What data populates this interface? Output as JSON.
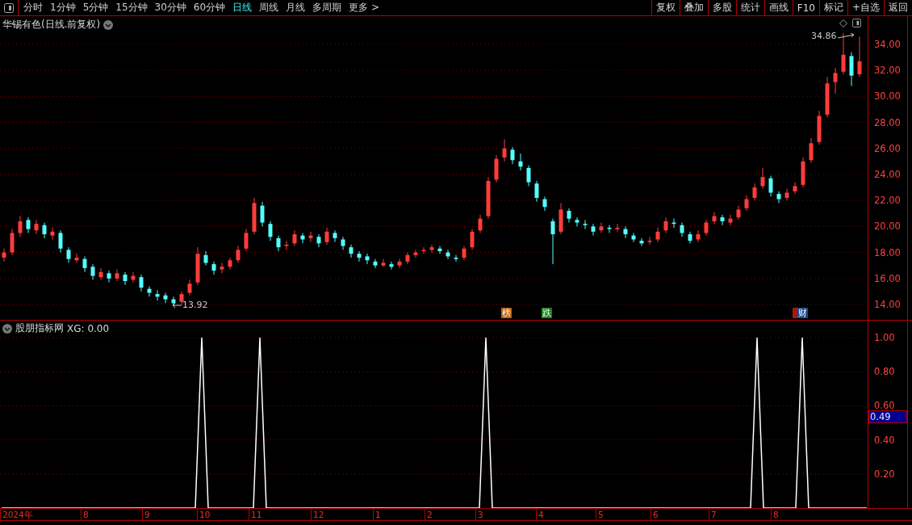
{
  "toolbar": {
    "periods": [
      {
        "label": "分时",
        "selected": false
      },
      {
        "label": "1分钟",
        "selected": false
      },
      {
        "label": "5分钟",
        "selected": false
      },
      {
        "label": "15分钟",
        "selected": false
      },
      {
        "label": "30分钟",
        "selected": false
      },
      {
        "label": "60分钟",
        "selected": false
      },
      {
        "label": "日线",
        "selected": true
      },
      {
        "label": "周线",
        "selected": false
      },
      {
        "label": "月线",
        "selected": false
      },
      {
        "label": "多周期",
        "selected": false
      },
      {
        "label": "更多 >",
        "selected": false
      }
    ],
    "actions": [
      "复权",
      "叠加",
      "多股",
      "统计",
      "画线",
      "F10",
      "标记",
      "+自选",
      "返回"
    ]
  },
  "stock": {
    "title": "华锡有色(日线.前复权)",
    "high_mark": "34.86",
    "low_mark": "13.92",
    "chart_data": {
      "type": "candlestick",
      "grid": true,
      "ylim": [
        12.82,
        36.17
      ],
      "yticks": [
        {
          "value": 34,
          "label": "34.00"
        },
        {
          "value": 32,
          "label": "32.00"
        },
        {
          "value": 30,
          "label": "30.00"
        },
        {
          "value": 28,
          "label": "28.00"
        },
        {
          "value": 26,
          "label": "26.00"
        },
        {
          "value": 24,
          "label": "24.00"
        },
        {
          "value": 22,
          "label": "22.00"
        },
        {
          "value": 20,
          "label": "20.00"
        },
        {
          "value": 18,
          "label": "18.00"
        },
        {
          "value": 16,
          "label": "16.00"
        },
        {
          "value": 14,
          "label": "14.00"
        }
      ],
      "ohlc": [
        [
          17.6,
          18.3,
          17.3,
          18.0
        ],
        [
          18.0,
          19.8,
          17.8,
          19.5
        ],
        [
          19.5,
          20.8,
          19.2,
          20.4
        ],
        [
          20.5,
          20.7,
          19.5,
          19.8
        ],
        [
          19.7,
          20.5,
          19.4,
          20.2
        ],
        [
          20.1,
          20.3,
          19.1,
          19.4
        ],
        [
          19.3,
          19.9,
          19.0,
          19.6
        ],
        [
          19.5,
          19.7,
          18.0,
          18.3
        ],
        [
          18.2,
          18.4,
          17.2,
          17.5
        ],
        [
          17.4,
          17.9,
          17.2,
          17.6
        ],
        [
          17.5,
          17.7,
          16.5,
          16.8
        ],
        [
          16.9,
          17.1,
          15.9,
          16.2
        ],
        [
          16.1,
          16.8,
          15.9,
          16.5
        ],
        [
          16.4,
          16.6,
          15.7,
          16.0
        ],
        [
          16.0,
          16.7,
          15.8,
          16.4
        ],
        [
          16.3,
          16.5,
          15.5,
          15.8
        ],
        [
          15.9,
          16.5,
          15.7,
          16.2
        ],
        [
          16.1,
          16.3,
          15.0,
          15.3
        ],
        [
          15.2,
          15.4,
          14.6,
          14.9
        ],
        [
          14.8,
          15.1,
          14.3,
          14.6
        ],
        [
          14.7,
          14.9,
          14.1,
          14.4
        ],
        [
          14.4,
          14.6,
          13.92,
          14.1
        ],
        [
          14.2,
          15.0,
          14.0,
          14.8
        ],
        [
          14.9,
          15.9,
          14.7,
          15.6
        ],
        [
          15.7,
          18.4,
          15.5,
          17.9
        ],
        [
          17.8,
          18.1,
          17.0,
          17.2
        ],
        [
          17.1,
          17.3,
          16.3,
          16.6
        ],
        [
          16.7,
          17.2,
          16.4,
          16.9
        ],
        [
          16.9,
          17.6,
          16.7,
          17.4
        ],
        [
          17.4,
          18.5,
          17.2,
          18.2
        ],
        [
          18.3,
          19.8,
          18.1,
          19.5
        ],
        [
          19.6,
          22.2,
          19.4,
          21.8
        ],
        [
          21.6,
          21.9,
          20.0,
          20.3
        ],
        [
          20.2,
          20.4,
          18.9,
          19.2
        ],
        [
          19.1,
          19.3,
          18.1,
          18.4
        ],
        [
          18.5,
          18.9,
          18.2,
          18.6
        ],
        [
          18.7,
          19.7,
          18.5,
          19.4
        ],
        [
          19.3,
          19.5,
          18.7,
          19.0
        ],
        [
          19.1,
          19.6,
          18.8,
          19.3
        ],
        [
          19.2,
          19.4,
          18.4,
          18.7
        ],
        [
          18.8,
          19.9,
          18.6,
          19.6
        ],
        [
          19.5,
          19.7,
          18.8,
          19.1
        ],
        [
          19.0,
          19.2,
          18.2,
          18.5
        ],
        [
          18.4,
          18.6,
          17.6,
          17.9
        ],
        [
          17.9,
          18.1,
          17.3,
          17.6
        ],
        [
          17.7,
          17.9,
          17.1,
          17.4
        ],
        [
          17.3,
          17.5,
          16.8,
          17.0
        ],
        [
          17.0,
          17.5,
          16.9,
          17.2
        ],
        [
          17.1,
          17.3,
          16.7,
          16.9
        ],
        [
          17.0,
          17.5,
          16.8,
          17.3
        ],
        [
          17.3,
          18.0,
          17.1,
          17.8
        ],
        [
          17.8,
          18.2,
          17.6,
          18.0
        ],
        [
          18.1,
          18.4,
          17.9,
          18.2
        ],
        [
          18.2,
          18.6,
          18.0,
          18.4
        ],
        [
          18.3,
          18.5,
          17.9,
          18.1
        ],
        [
          18.0,
          18.2,
          17.5,
          17.7
        ],
        [
          17.6,
          17.8,
          17.3,
          17.5
        ],
        [
          17.6,
          18.5,
          17.4,
          18.3
        ],
        [
          18.4,
          19.8,
          18.2,
          19.6
        ],
        [
          19.7,
          20.9,
          19.5,
          20.6
        ],
        [
          20.8,
          23.8,
          20.6,
          23.5
        ],
        [
          23.6,
          25.5,
          23.4,
          25.2
        ],
        [
          25.3,
          26.7,
          25.0,
          26.0
        ],
        [
          25.9,
          26.1,
          24.8,
          25.1
        ],
        [
          25.0,
          25.6,
          24.3,
          24.6
        ],
        [
          24.5,
          24.7,
          23.1,
          23.4
        ],
        [
          23.3,
          23.5,
          21.9,
          22.2
        ],
        [
          22.1,
          22.3,
          21.2,
          21.5
        ],
        [
          20.4,
          20.6,
          17.1,
          19.4
        ],
        [
          19.6,
          21.8,
          19.4,
          21.3
        ],
        [
          21.2,
          21.4,
          20.3,
          20.6
        ],
        [
          20.5,
          20.7,
          20.0,
          20.3
        ],
        [
          20.2,
          20.5,
          19.8,
          20.1
        ],
        [
          20.0,
          20.2,
          19.3,
          19.6
        ],
        [
          19.7,
          20.3,
          19.5,
          20.0
        ],
        [
          19.9,
          20.1,
          19.5,
          19.8
        ],
        [
          19.8,
          20.2,
          19.6,
          19.9
        ],
        [
          19.8,
          20.0,
          19.1,
          19.4
        ],
        [
          19.3,
          19.5,
          18.8,
          19.0
        ],
        [
          18.9,
          19.1,
          18.5,
          18.7
        ],
        [
          18.8,
          19.2,
          18.6,
          18.9
        ],
        [
          19.0,
          19.9,
          18.8,
          19.6
        ],
        [
          19.7,
          20.7,
          19.5,
          20.4
        ],
        [
          20.3,
          20.6,
          19.9,
          20.2
        ],
        [
          20.1,
          20.3,
          19.2,
          19.5
        ],
        [
          19.4,
          19.6,
          18.7,
          18.9
        ],
        [
          19.0,
          19.7,
          18.8,
          19.4
        ],
        [
          19.5,
          20.5,
          19.3,
          20.3
        ],
        [
          20.4,
          21.1,
          20.2,
          20.8
        ],
        [
          20.7,
          20.9,
          20.1,
          20.4
        ],
        [
          20.3,
          20.9,
          20.1,
          20.6
        ],
        [
          20.7,
          21.6,
          20.5,
          21.3
        ],
        [
          21.4,
          22.4,
          21.2,
          22.1
        ],
        [
          22.2,
          23.3,
          22.0,
          23.0
        ],
        [
          23.1,
          24.5,
          22.9,
          23.8
        ],
        [
          23.7,
          23.9,
          22.3,
          22.6
        ],
        [
          22.5,
          22.7,
          21.8,
          22.1
        ],
        [
          22.2,
          22.9,
          22.0,
          22.6
        ],
        [
          22.7,
          23.4,
          22.5,
          23.1
        ],
        [
          23.2,
          25.3,
          23.0,
          25.0
        ],
        [
          25.1,
          26.8,
          24.9,
          26.4
        ],
        [
          26.5,
          28.9,
          26.3,
          28.5
        ],
        [
          28.6,
          31.5,
          28.4,
          31.0
        ],
        [
          31.1,
          32.2,
          30.2,
          31.8
        ],
        [
          31.9,
          34.86,
          31.7,
          33.2
        ],
        [
          33.1,
          33.4,
          30.8,
          31.6
        ],
        [
          31.7,
          34.6,
          31.5,
          32.7
        ]
      ]
    }
  },
  "event_tags": [
    {
      "label": "榜",
      "color": "#b8600a"
    },
    {
      "label": "跌",
      "color": "#18801c"
    },
    {
      "label": "财",
      "color": "#1c4a8a"
    }
  ],
  "indicator": {
    "title": "股朋指标网",
    "reading": ": 0.00",
    "cursor_value": "0.49",
    "chart_data": {
      "type": "line",
      "grid": true,
      "ylim": [
        0,
        1.1
      ],
      "yticks": [
        {
          "value": 1,
          "label": "1.00"
        },
        {
          "value": 0.8,
          "label": "0.80"
        },
        {
          "value": 0.6,
          "label": "0.60"
        },
        {
          "value": 0.4,
          "label": "0.40"
        },
        {
          "value": 0.2,
          "label": "0.20"
        }
      ],
      "series": [
        {
          "name": "XG",
          "color": "#ffffff",
          "values": [
            0,
            0,
            0,
            0,
            0,
            0,
            0,
            0,
            0,
            0,
            0,
            0,
            0,
            0,
            0,
            0,
            0,
            0,
            0,
            0,
            0,
            0,
            0,
            0,
            0,
            0,
            0,
            0,
            0,
            0,
            0,
            1,
            0,
            0,
            0,
            0,
            0,
            0,
            0,
            0,
            1,
            0,
            0,
            0,
            0,
            0,
            0,
            0,
            0,
            0,
            0,
            0,
            0,
            0,
            0,
            0,
            0,
            0,
            0,
            0,
            0,
            0,
            0,
            0,
            0,
            0,
            0,
            0,
            0,
            0,
            0,
            0,
            0,
            0,
            0,
            1,
            0,
            0,
            0,
            0,
            0,
            0,
            0,
            0,
            0,
            0,
            0,
            0,
            0,
            0,
            0,
            0,
            0,
            0,
            0,
            0,
            0,
            0,
            0,
            0,
            0,
            0,
            0,
            0,
            0,
            0,
            0,
            0,
            0,
            0,
            0,
            0,
            0,
            0,
            0,
            0,
            0,
            1,
            0,
            0,
            0,
            0,
            0,
            0,
            1,
            0,
            0,
            0,
            0,
            0,
            0,
            0,
            0,
            0,
            0
          ]
        }
      ]
    }
  },
  "date_axis": [
    "2024年",
    "8",
    "9",
    "10",
    "11",
    "12",
    "1",
    "2",
    "3",
    "4",
    "5",
    "6",
    "7",
    "8"
  ]
}
